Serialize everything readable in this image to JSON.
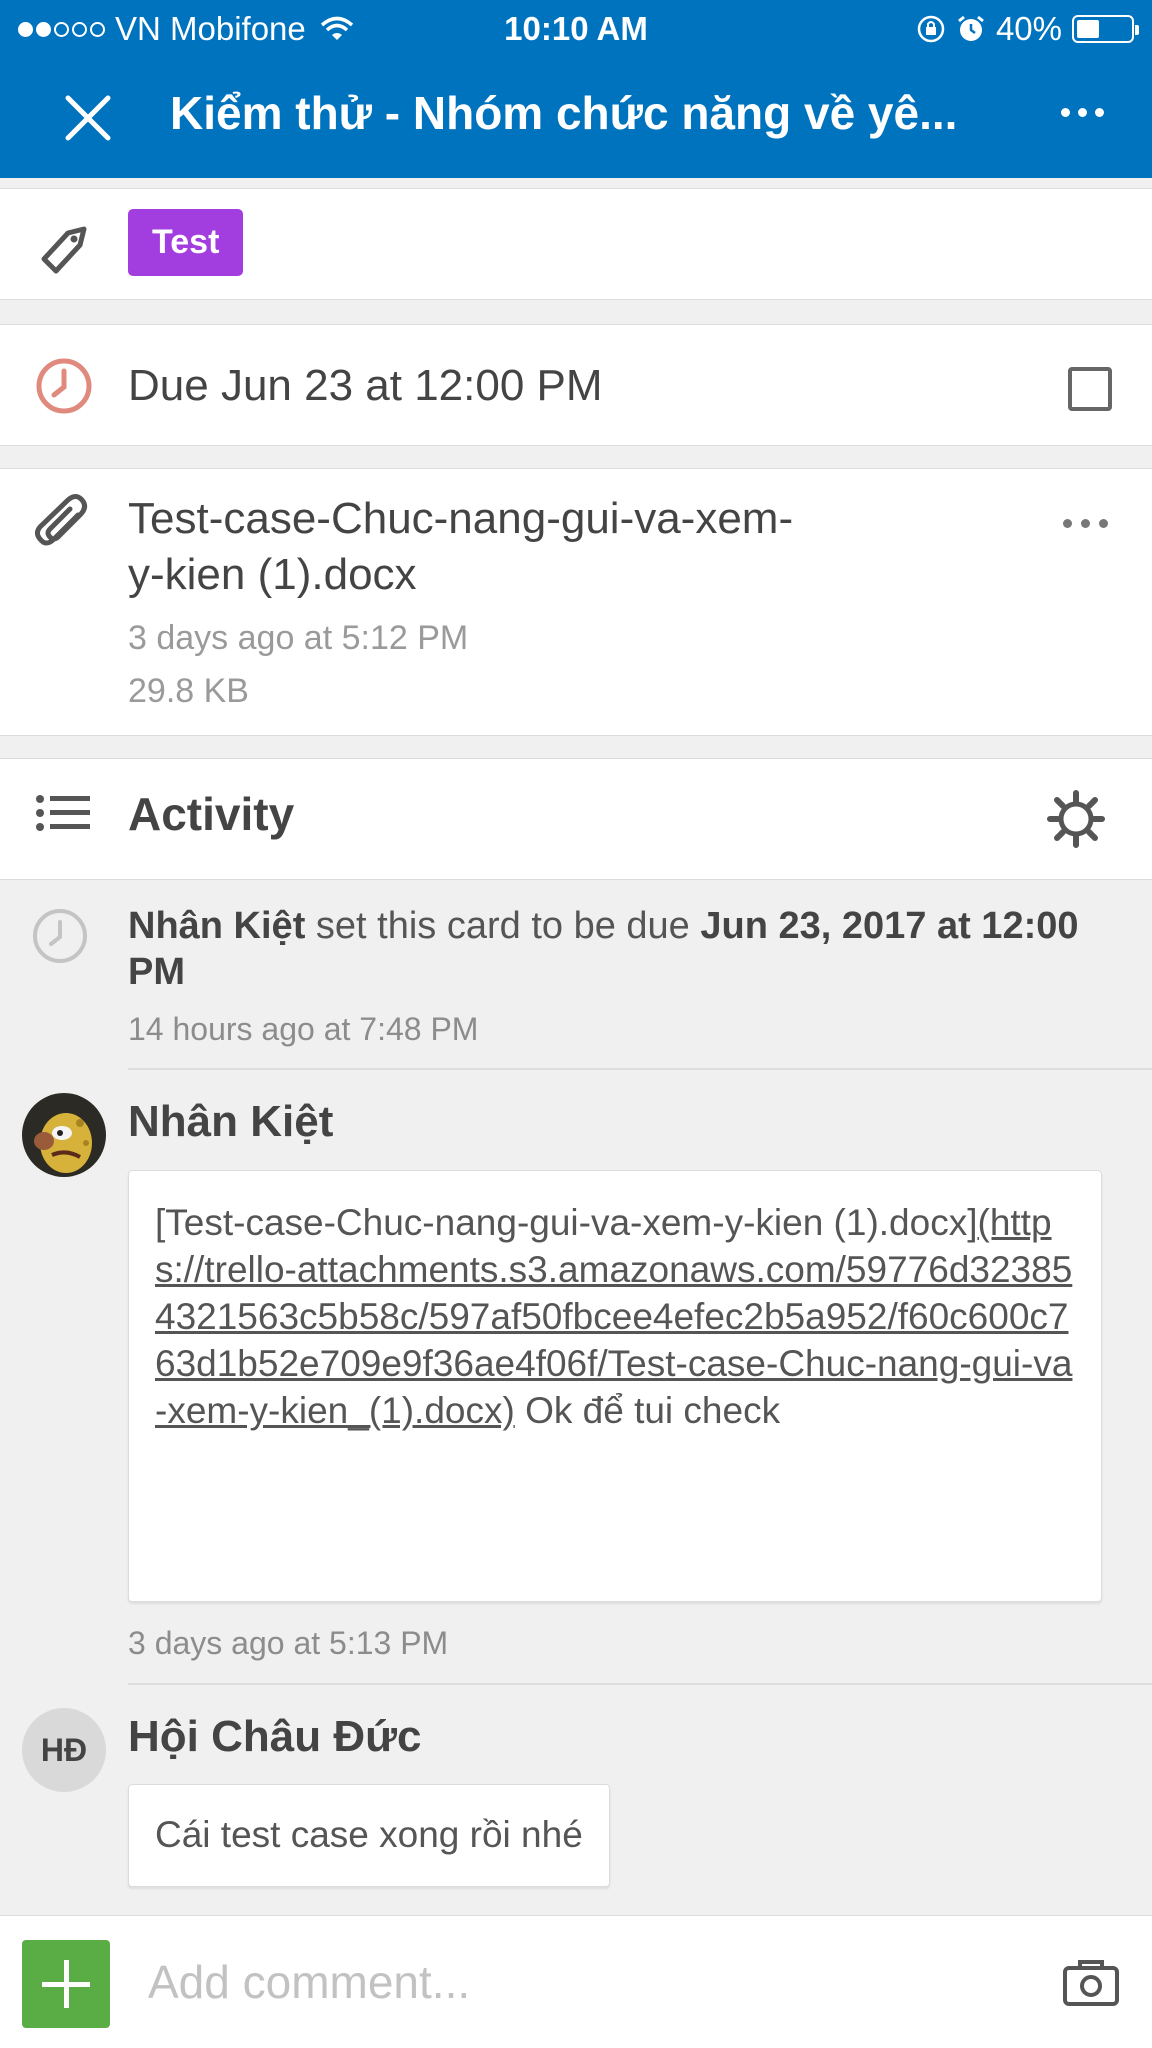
{
  "status_bar": {
    "carrier": "VN Mobifone",
    "time": "10:10 AM",
    "battery": "40%",
    "battery_level": 0.4
  },
  "header": {
    "title": "Kiểm thử - Nhóm chức năng về yê..."
  },
  "labels": [
    {
      "text": "Test",
      "color": "#a23ee0"
    }
  ],
  "due": {
    "text": "Due Jun 23 at 12:00 PM",
    "checked": false
  },
  "attachment": {
    "name": "Test-case-Chuc-nang-gui-va-xem-y-kien (1).docx",
    "time": "3 days ago at 5:12 PM",
    "size": "29.8 KB"
  },
  "activity": {
    "title": "Activity",
    "items": [
      {
        "type": "event",
        "actor": "Nhân Kiệt",
        "action": " set this card to be due ",
        "date": "Jun 23, 2017 at 12:00 PM",
        "time": "14 hours ago at 7:48 PM"
      },
      {
        "type": "comment",
        "author": "Nhân Kiệt",
        "text_prefix": "[Test-case-Chuc-nang-gui-va-xem-y-kien (1).docx]",
        "link": "(https://trello-attachments.s3.amazonaws.com/59776d323854321563c5b58c/597af50fbcee4efec2b5a952/f60c600c763d1b52e709e9f36ae4f06f/Test-case-Chuc-nang-gui-va-xem-y-kien_(1).docx)",
        "text_suffix": " Ok để tui check",
        "time": "3 days ago at 5:13 PM"
      },
      {
        "type": "comment",
        "author": "Hội Châu Đức",
        "initials": "HĐ",
        "text": "Cái test case xong rồi nhé"
      }
    ]
  },
  "footer": {
    "placeholder": "Add comment..."
  },
  "colors": {
    "brand": "#0073be",
    "label_purple": "#a23ee0",
    "due_icon": "#e08a7e",
    "add_button": "#5aac44"
  },
  "icons": [
    "close-icon",
    "more-icon",
    "tag-icon",
    "clock-icon",
    "paperclip-icon",
    "list-icon",
    "gear-icon",
    "plus-icon",
    "camera-icon",
    "wifi-icon",
    "alarm-icon",
    "lock-rotation-icon"
  ]
}
